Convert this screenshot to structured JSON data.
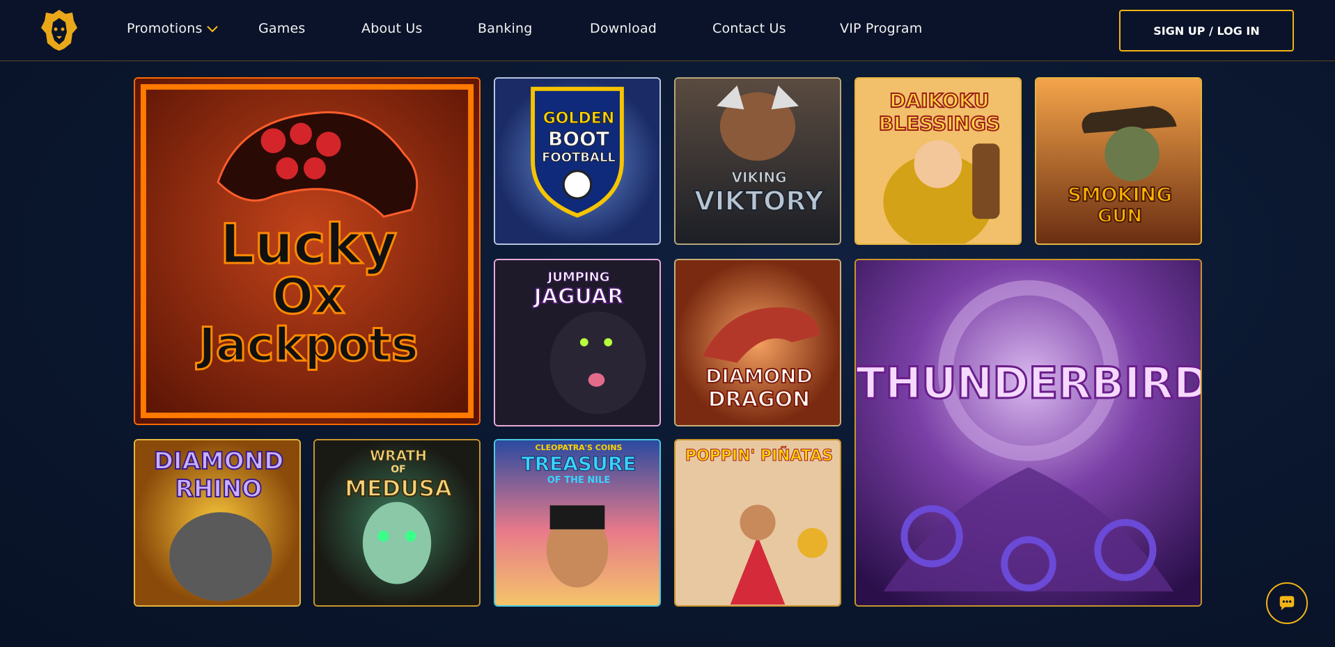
{
  "header": {
    "logo_icon": "lion-head-icon",
    "nav": [
      {
        "label": "Promotions"
      },
      {
        "label": "Games"
      },
      {
        "label": "About Us"
      },
      {
        "label": "Banking"
      },
      {
        "label": "Download"
      },
      {
        "label": "Contact Us"
      },
      {
        "label": "VIP Program"
      }
    ],
    "signup_label": "SIGN UP / LOG IN"
  },
  "games": [
    {
      "line1": "Lucky",
      "line2": "Ox",
      "line3": "Jackpots"
    },
    {
      "line1": "GOLDEN",
      "line2": "BOOT",
      "line3": "FOOTBALL"
    },
    {
      "line1": "VIKING",
      "line2": "VIKTORY"
    },
    {
      "line1": "DAIKOKU",
      "line2": "BLESSINGS"
    },
    {
      "line1": "SMOKING",
      "line2": "GUN"
    },
    {
      "line1": "JUMPING",
      "line2": "JAGUAR"
    },
    {
      "line1": "DIAMOND",
      "line2": "DRAGON"
    },
    {
      "line1": "THUNDERBIRD"
    },
    {
      "line1": "DIAMOND",
      "line2": "RHINO"
    },
    {
      "line1": "WRATH",
      "line2": "OF",
      "line3": "MEDUSA"
    },
    {
      "line1": "CLEOPATRA'S COINS",
      "line2": "TREASURE",
      "line3": "OF THE NILE"
    },
    {
      "line1": "POPPIN' PIÑATAS"
    }
  ],
  "colors": {
    "accent": "#f2b417",
    "header_bg": "#0a1329",
    "page_bg": "#0b1830"
  },
  "chat_icon": "chat-bubble-icon"
}
